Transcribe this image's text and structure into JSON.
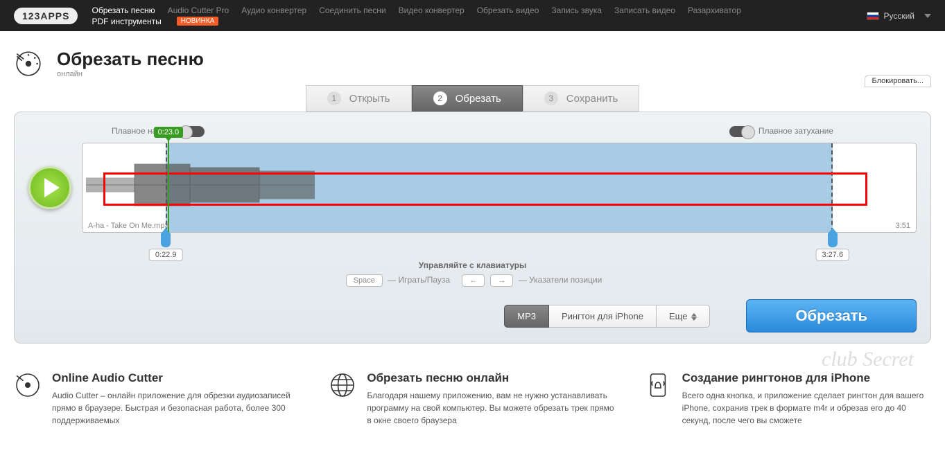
{
  "nav": {
    "logo": "123APPS",
    "links": [
      "Обрезать песню",
      "Audio Cutter Pro",
      "Аудио конвертер",
      "Соединить песни",
      "Видео конвертер",
      "Обрезать видео",
      "Запись звука",
      "Записать видео",
      "Разархиватор"
    ],
    "link2": "PDF инструменты",
    "badge": "НОВИНКА",
    "lang": "Русский"
  },
  "header": {
    "title": "Обрезать песню",
    "sub": "онлайн"
  },
  "block": "Блокировать...",
  "steps": [
    {
      "n": "1",
      "label": "Открыть"
    },
    {
      "n": "2",
      "label": "Обрезать"
    },
    {
      "n": "3",
      "label": "Сохранить"
    }
  ],
  "fade": {
    "in": "Плавное начало",
    "out": "Плавное затухание"
  },
  "track": {
    "name": "A-ha - Take On Me.mp3",
    "dur": "3:51",
    "play": "0:23.0",
    "start": "0:22.9",
    "end": "3:27.6"
  },
  "kbd": {
    "title": "Управляйте с клавиатуры",
    "space": "Space",
    "spacetxt": "Играть/Пауза",
    "l": "←",
    "r": "→",
    "arrtxt": "Указатели позиции"
  },
  "formats": {
    "mp3": "MP3",
    "ring": "Рингтон для iPhone",
    "more": "Еще"
  },
  "cut": "Обрезать",
  "features": [
    {
      "title": "Online Audio Cutter",
      "text": "Audio Cutter – онлайн приложение для обрезки аудиозаписей прямо в браузере. Быстрая и безопасная работа, более 300 поддерживаемых"
    },
    {
      "title": "Обрезать песню онлайн",
      "text": "Благодаря нашему приложению, вам не нужно устанавливать программу на свой компьютер. Вы можете обрезать трек прямо в окне своего браузера"
    },
    {
      "title": "Создание рингтонов для iPhone",
      "text": "Всего одна кнопка, и приложение сделает рингтон для вашего iPhone, сохранив трек в формате m4r и обрезав его до 40 секунд, после чего вы сможете"
    }
  ],
  "wm": "club Secret"
}
